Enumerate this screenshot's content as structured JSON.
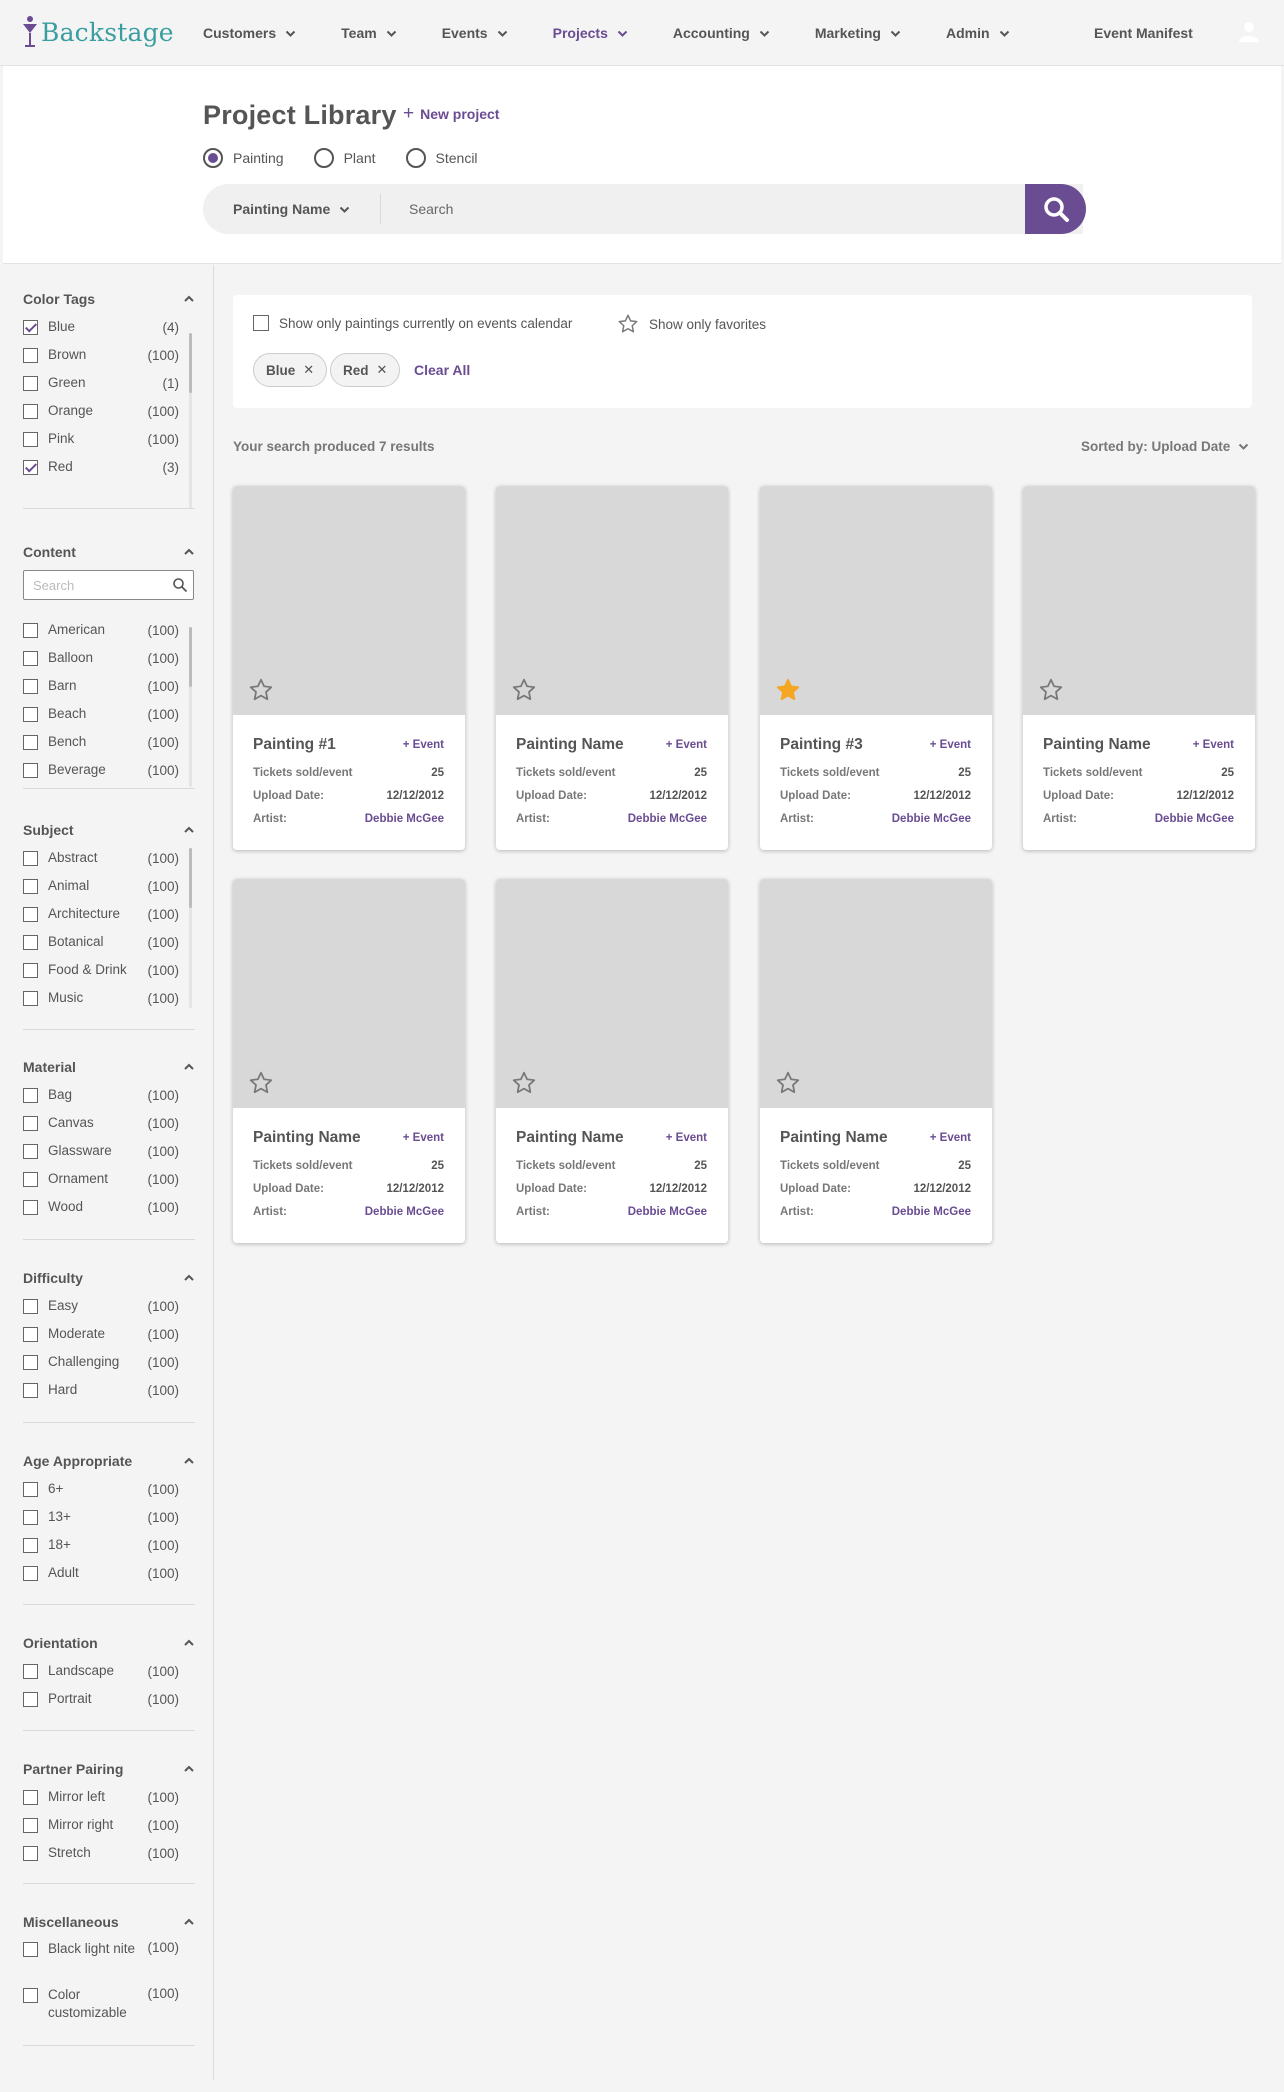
{
  "nav": {
    "logo": "Backstage",
    "items": [
      {
        "label": "Customers",
        "active": false
      },
      {
        "label": "Team",
        "active": false
      },
      {
        "label": "Events",
        "active": false
      },
      {
        "label": "Projects",
        "active": true
      },
      {
        "label": "Accounting",
        "active": false
      },
      {
        "label": "Marketing",
        "active": false
      },
      {
        "label": "Admin",
        "active": false
      }
    ],
    "event_manifest": "Event Manifest",
    "avatar_icon": "user-icon"
  },
  "header": {
    "title": "Project Library",
    "new_project": "New project",
    "radios": [
      {
        "label": "Painting",
        "checked": true
      },
      {
        "label": "Plant",
        "checked": false
      },
      {
        "label": "Stencil",
        "checked": false
      }
    ],
    "search_field": "Painting Name",
    "search_placeholder": "Search"
  },
  "filters": {
    "calendar_label": "Show only paintings currently on events calendar",
    "favorites_label": "Show only favorites",
    "chips": [
      "Blue",
      "Red"
    ],
    "clear_all": "Clear All"
  },
  "results": {
    "summary": "Your search produced 7 results",
    "sort": "Sorted by: Upload Date"
  },
  "facets": [
    {
      "title": "Color Tags",
      "options": [
        {
          "label": "Blue",
          "count": "(4)",
          "checked": true
        },
        {
          "label": "Brown",
          "count": "(100)",
          "checked": false
        },
        {
          "label": "Green",
          "count": "(1)",
          "checked": false
        },
        {
          "label": "Orange",
          "count": "(100)",
          "checked": false
        },
        {
          "label": "Pink",
          "count": "(100)",
          "checked": false
        },
        {
          "label": "Red",
          "count": "(3)",
          "checked": true
        }
      ]
    },
    {
      "title": "Content",
      "search_placeholder": "Search",
      "options": [
        {
          "label": "American",
          "count": "(100)",
          "checked": false
        },
        {
          "label": "Balloon",
          "count": "(100)",
          "checked": false
        },
        {
          "label": "Barn",
          "count": "(100)",
          "checked": false
        },
        {
          "label": "Beach",
          "count": "(100)",
          "checked": false
        },
        {
          "label": "Bench",
          "count": "(100)",
          "checked": false
        },
        {
          "label": "Beverage",
          "count": "(100)",
          "checked": false
        }
      ]
    },
    {
      "title": "Subject",
      "options": [
        {
          "label": "Abstract",
          "count": "(100)",
          "checked": false
        },
        {
          "label": "Animal",
          "count": "(100)",
          "checked": false
        },
        {
          "label": "Architecture",
          "count": "(100)",
          "checked": false
        },
        {
          "label": "Botanical",
          "count": "(100)",
          "checked": false
        },
        {
          "label": "Food & Drink",
          "count": "(100)",
          "checked": false
        },
        {
          "label": "Music",
          "count": "(100)",
          "checked": false
        }
      ]
    },
    {
      "title": "Material",
      "options": [
        {
          "label": "Bag",
          "count": "(100)",
          "checked": false
        },
        {
          "label": "Canvas",
          "count": "(100)",
          "checked": false
        },
        {
          "label": "Glassware",
          "count": "(100)",
          "checked": false
        },
        {
          "label": "Ornament",
          "count": "(100)",
          "checked": false
        },
        {
          "label": "Wood",
          "count": "(100)",
          "checked": false
        }
      ]
    },
    {
      "title": "Difficulty",
      "options": [
        {
          "label": "Easy",
          "count": "(100)",
          "checked": false
        },
        {
          "label": "Moderate",
          "count": "(100)",
          "checked": false
        },
        {
          "label": "Challenging",
          "count": "(100)",
          "checked": false
        },
        {
          "label": "Hard",
          "count": "(100)",
          "checked": false
        }
      ]
    },
    {
      "title": "Age Appropriate",
      "options": [
        {
          "label": "6+",
          "count": "(100)",
          "checked": false
        },
        {
          "label": "13+",
          "count": "(100)",
          "checked": false
        },
        {
          "label": "18+",
          "count": "(100)",
          "checked": false
        },
        {
          "label": "Adult",
          "count": "(100)",
          "checked": false
        }
      ]
    },
    {
      "title": "Orientation",
      "options": [
        {
          "label": "Landscape",
          "count": "(100)",
          "checked": false
        },
        {
          "label": "Portrait",
          "count": "(100)",
          "checked": false
        }
      ]
    },
    {
      "title": "Partner Pairing",
      "options": [
        {
          "label": "Mirror left",
          "count": "(100)",
          "checked": false
        },
        {
          "label": "Mirror right",
          "count": "(100)",
          "checked": false
        },
        {
          "label": "Stretch",
          "count": "(100)",
          "checked": false
        }
      ]
    },
    {
      "title": "Miscellaneous",
      "options": [
        {
          "label": "Black light nite",
          "count": "(100)",
          "checked": false
        },
        {
          "label": "Color customizable",
          "count": "(100)",
          "checked": false
        }
      ]
    }
  ],
  "card_labels": {
    "add_event": "+ Event",
    "tickets": "Tickets sold/event",
    "upload": "Upload Date:",
    "artist": "Artist:"
  },
  "cards": [
    {
      "name": "Painting #1",
      "tickets": "25",
      "date": "12/12/2012",
      "artist": "Debbie McGee",
      "favorite": false
    },
    {
      "name": "Painting Name",
      "tickets": "25",
      "date": "12/12/2012",
      "artist": "Debbie McGee",
      "favorite": false
    },
    {
      "name": "Painting #3",
      "tickets": "25",
      "date": "12/12/2012",
      "artist": "Debbie McGee",
      "favorite": true
    },
    {
      "name": "Painting Name",
      "tickets": "25",
      "date": "12/12/2012",
      "artist": "Debbie McGee",
      "favorite": false
    },
    {
      "name": "Painting Name",
      "tickets": "25",
      "date": "12/12/2012",
      "artist": "Debbie McGee",
      "favorite": false
    },
    {
      "name": "Painting Name",
      "tickets": "25",
      "date": "12/12/2012",
      "artist": "Debbie McGee",
      "favorite": false
    },
    {
      "name": "Painting Name",
      "tickets": "25",
      "date": "12/12/2012",
      "artist": "Debbie McGee",
      "favorite": false
    }
  ],
  "colors": {
    "accent": "#6a4c93",
    "logo": "#3a9ea0",
    "favorite": "#f5a623",
    "thumb": "#d8d8d8"
  }
}
